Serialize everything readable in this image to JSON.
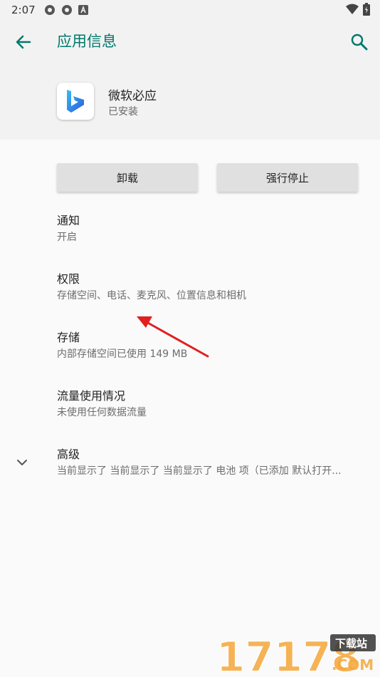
{
  "status_bar": {
    "time": "2:07"
  },
  "header": {
    "title": "应用信息",
    "app_name": "微软必应",
    "app_status": "已安装"
  },
  "buttons": {
    "uninstall": "卸载",
    "force_stop": "强行停止"
  },
  "settings": [
    {
      "title": "通知",
      "summary": "开启"
    },
    {
      "title": "权限",
      "summary": "存储空间、电话、麦克风、位置信息和相机"
    },
    {
      "title": "存储",
      "summary": "内部存储空间已使用 149 MB"
    },
    {
      "title": "流量使用情况",
      "summary": "未使用任何数据流量"
    },
    {
      "title": "高级",
      "summary": "当前显示了 当前显示了 当前显示了 电池 项（已添加 默认打开..."
    }
  ],
  "watermark": {
    "number": "17178",
    "tag": "下载站",
    "domain": ".COM"
  },
  "colors": {
    "accent": "#00796b",
    "annotation_arrow": "#e02020"
  }
}
